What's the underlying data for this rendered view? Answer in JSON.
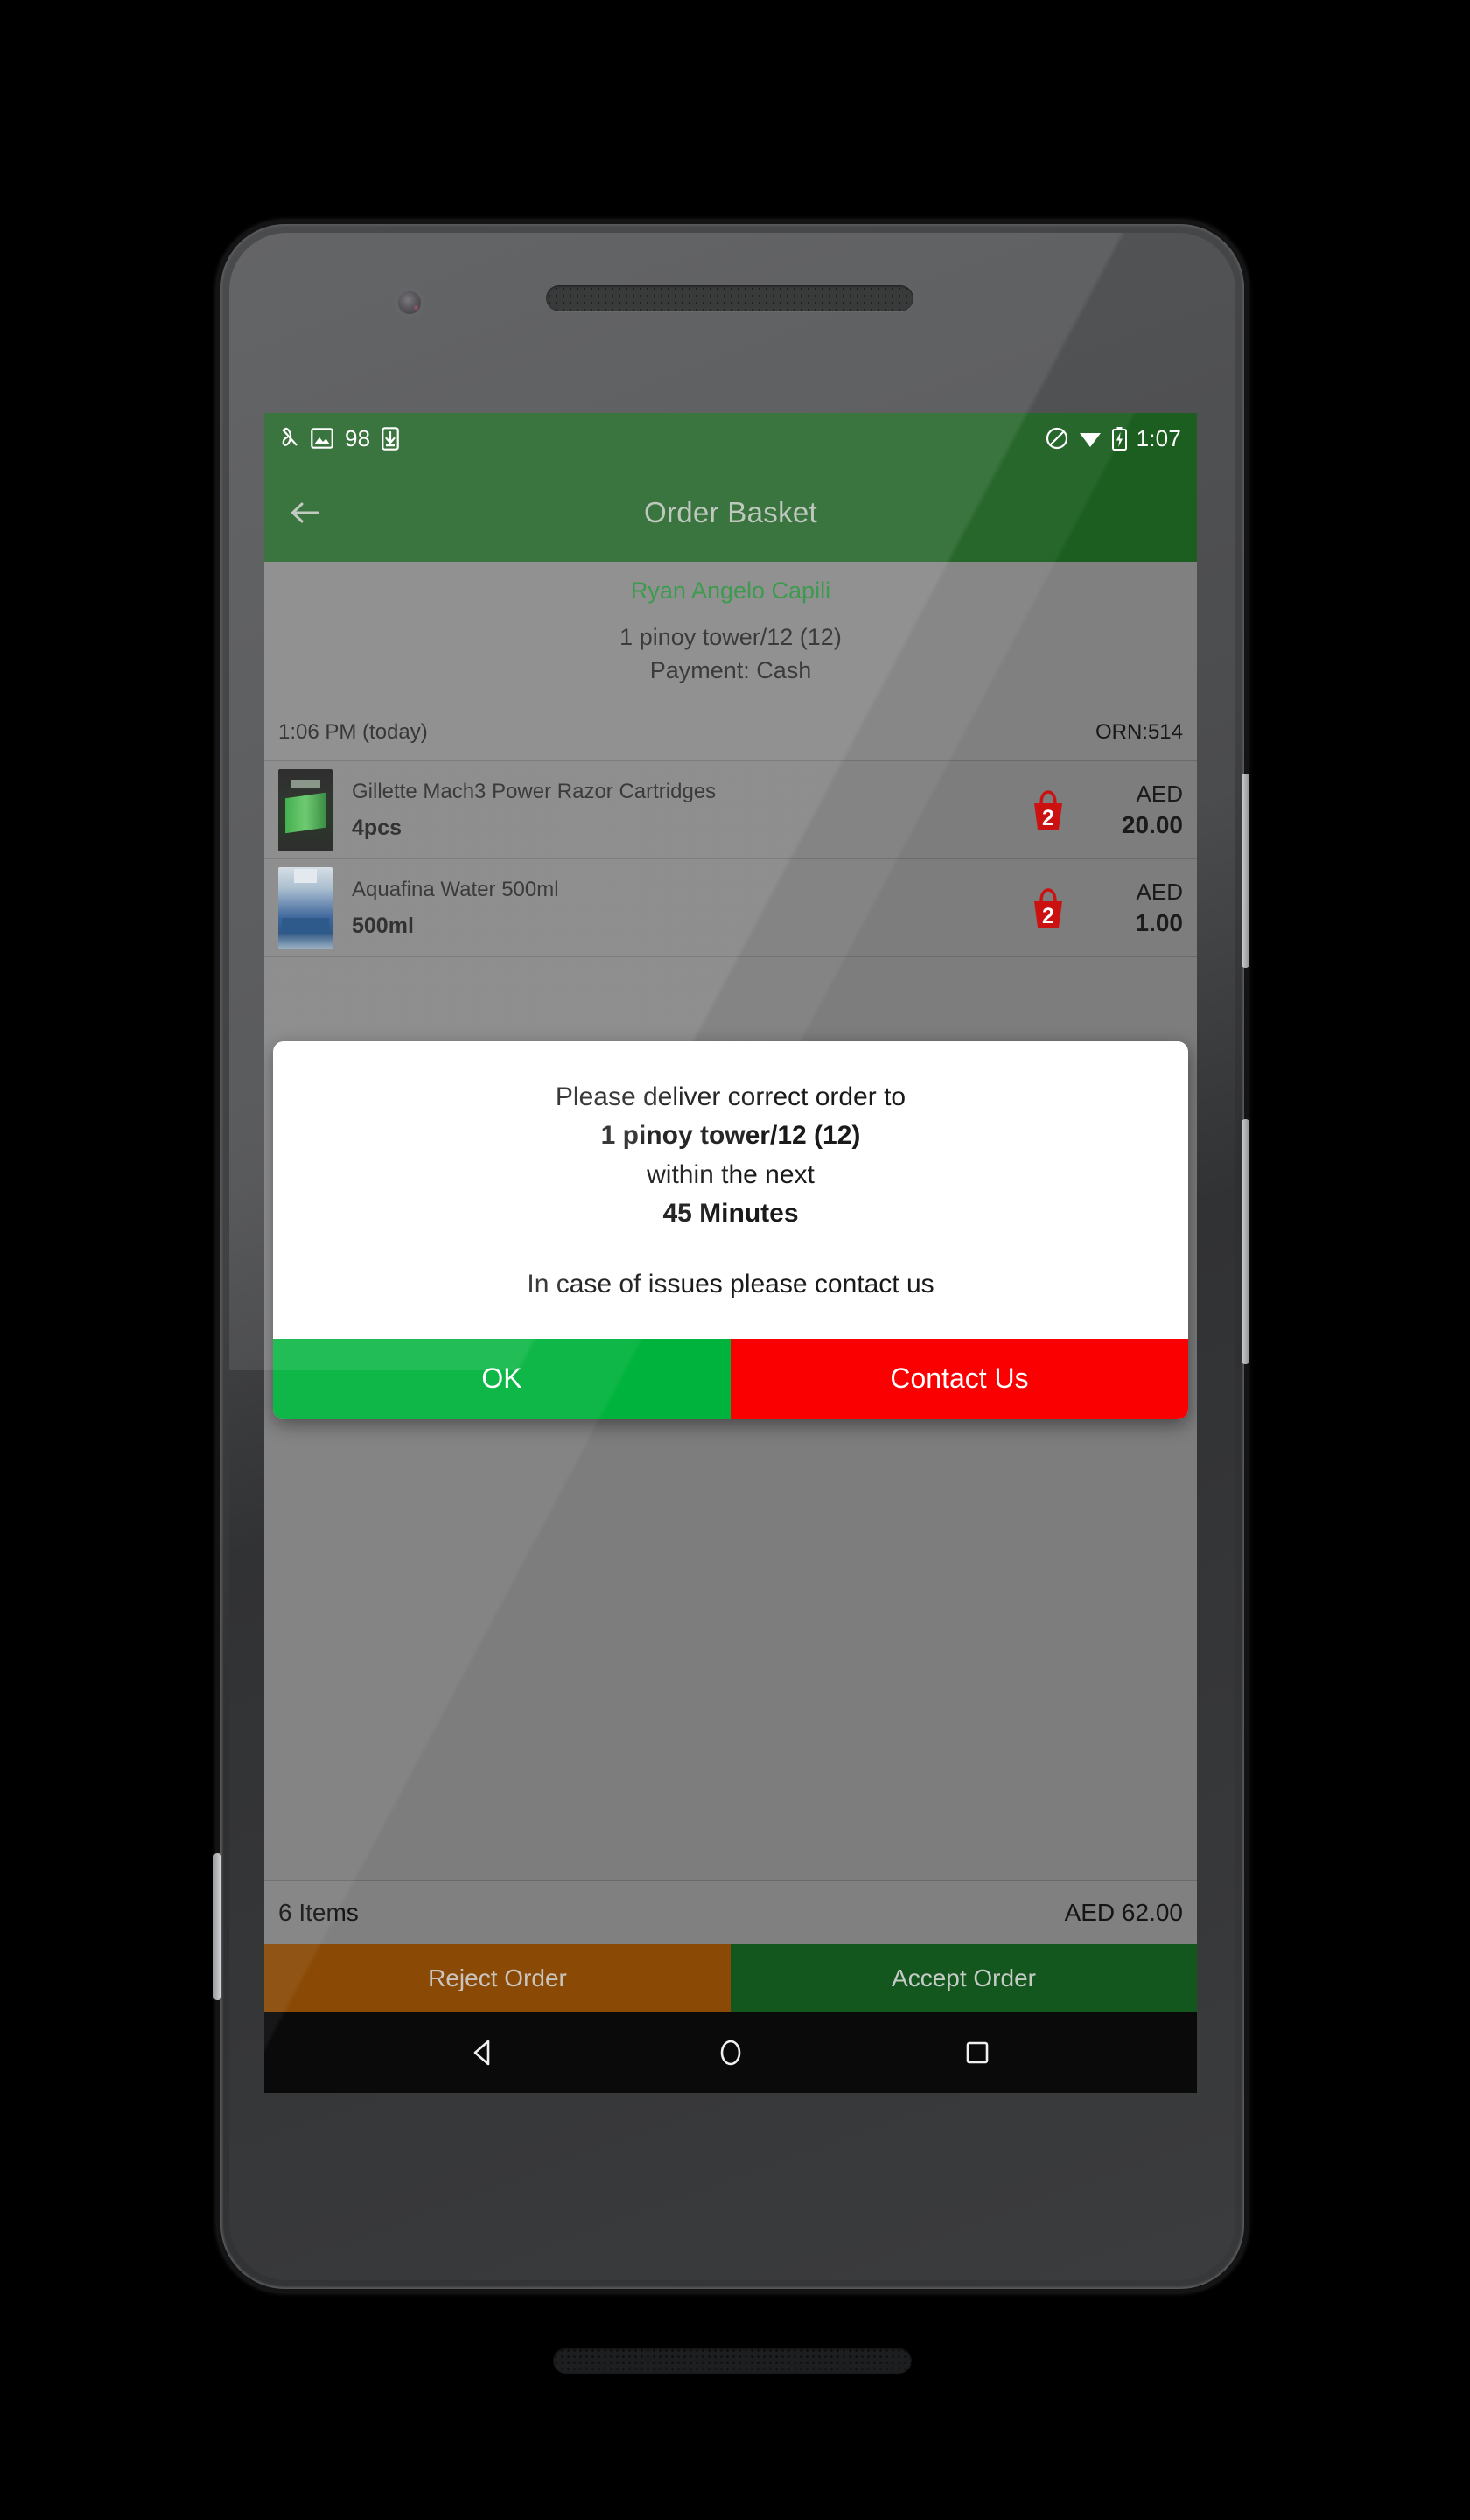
{
  "statusbar": {
    "battery_percent": "98",
    "time": "1:07",
    "left_icons": [
      "no-sim-slash-icon",
      "image-icon",
      "battery-percent-text",
      "download-icon"
    ],
    "right_icons": [
      "do-not-disturb-icon",
      "wifi-icon",
      "battery-charging-icon"
    ]
  },
  "appbar": {
    "title": "Order Basket",
    "back_icon": "back-arrow-icon"
  },
  "customer": {
    "name": "Ryan Angelo Capili",
    "address": "1 pinoy tower/12 (12)",
    "payment": "Payment: Cash"
  },
  "orderline": {
    "time": "1:06 PM (today)",
    "reference": "ORN:514"
  },
  "items": [
    {
      "name": "Gillette Mach3 Power Razor Cartridges",
      "qty_label": "4pcs",
      "basket_count": "2",
      "currency": "AED",
      "price": "20.00",
      "thumb": "razor-pack-image"
    },
    {
      "name": "Aquafina Water 500ml",
      "qty_label": "500ml",
      "basket_count": "2",
      "currency": "AED",
      "price": "1.00",
      "thumb": "water-bottle-image"
    }
  ],
  "totals": {
    "items_label": "6 Items",
    "amount": "AED 62.00"
  },
  "actions": {
    "reject": "Reject Order",
    "accept": "Accept Order"
  },
  "dialog": {
    "line1": "Please deliver correct order to",
    "line2": "1 pinoy tower/12 (12)",
    "line3": "within the next",
    "line4": "45 Minutes",
    "line5": "In case of issues please contact us",
    "ok": "OK",
    "contact": "Contact Us"
  },
  "navbar": {
    "back": "nav-back-icon",
    "home": "nav-home-icon",
    "recents": "nav-recents-icon"
  },
  "colors": {
    "app_green": "#1b5e20",
    "customer_name_green": "#1e8c32",
    "accept_green": "#13571f",
    "reject_brown": "#8a4a06",
    "dialog_ok_green": "#00b33c",
    "dialog_contact_red": "#fa0000",
    "badge_red": "#cc1111",
    "screen_gray": "#7d7d7d"
  }
}
